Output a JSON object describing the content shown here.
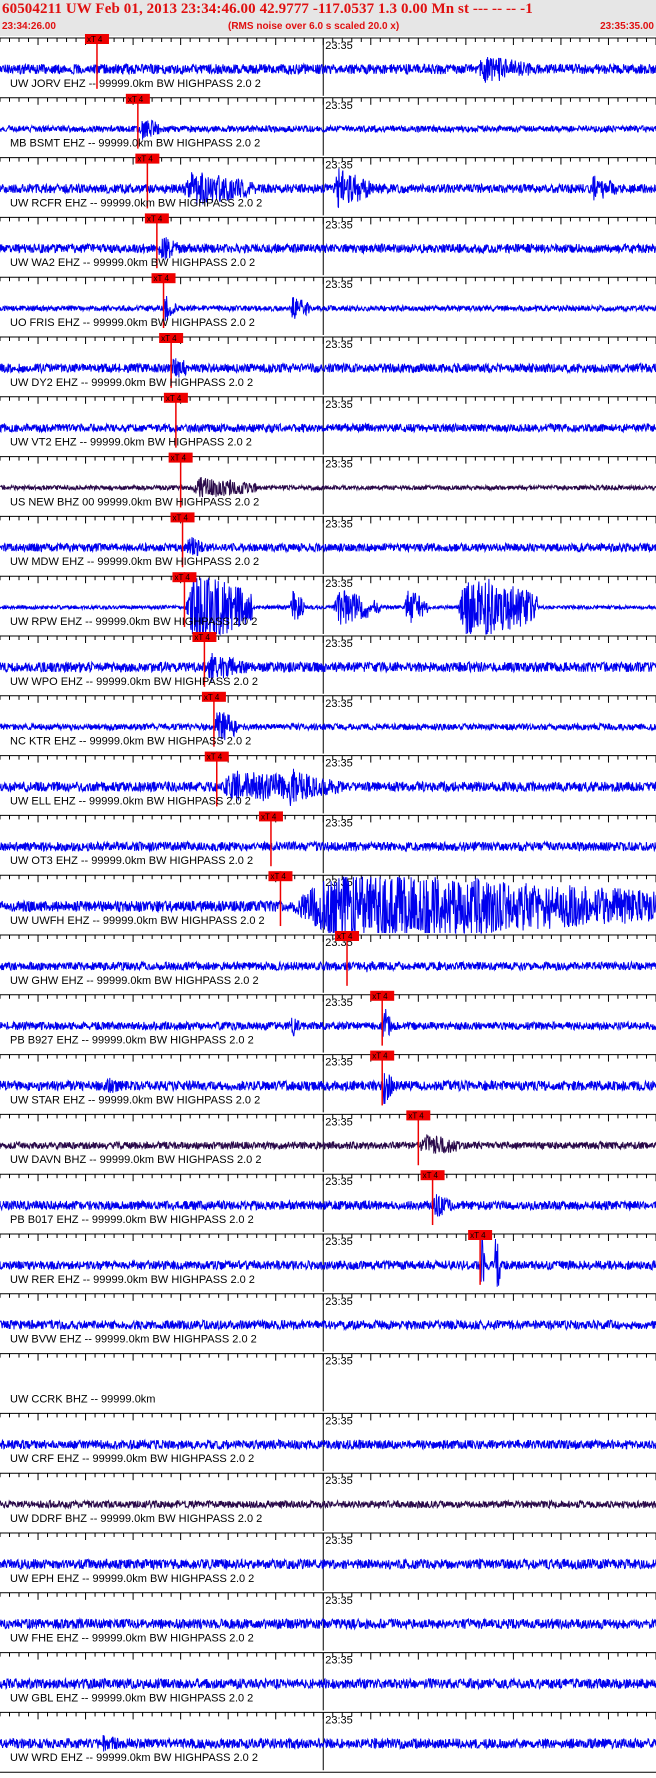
{
  "header": {
    "title": "60504211 UW Feb 01, 2013 23:34:46.00   42.9777 -117.0537  1.3 0.00 Mn st --- -- --  -1",
    "start_time": "23:34:26.00",
    "subtitle": "(RMS noise over 6.0 s scaled 20.0 x)",
    "end_time": "23:35:35.00"
  },
  "colors": {
    "header_text": "#e01010",
    "header_bg": "#e6e6e6",
    "trace_blue": "#0000ee",
    "trace_dark": "#2a0a4a",
    "pick_red": "#ee0000"
  },
  "chart_data": {
    "type": "line",
    "x_range": [
      "23:34:26.00",
      "23:35:35.00"
    ],
    "tick_label": "23:35",
    "pick_label": "xT 4",
    "channels": [
      {
        "label": "UW JORV EHZ -- 99999.0km BW  HIGHPASS  2.0  2",
        "color": "blue",
        "pick": "23:34:36.2",
        "amp": 0.55,
        "bursts": [
          [
            "23:35:16.0",
            "23:35:22.0",
            3.0
          ]
        ]
      },
      {
        "label": "MB BSMT EHZ -- 99999.0km BW  HIGHPASS  2.0  2",
        "color": "blue",
        "pick": "23:34:40.5",
        "amp": 0.35,
        "bursts": [
          [
            "23:34:40.5",
            "23:34:43.0",
            4.0
          ]
        ]
      },
      {
        "label": "UW RCFR EHZ -- 99999.0km BW  HIGHPASS  2.0  2",
        "color": "blue",
        "pick": "23:34:41.5",
        "amp": 0.5,
        "bursts": [
          [
            "23:34:45.0",
            "23:34:53.0",
            4.0
          ],
          [
            "23:35:01.0",
            "23:35:05.0",
            4.5
          ],
          [
            "23:35:28.0",
            "23:35:31.0",
            3.0
          ]
        ]
      },
      {
        "label": "UW WA2 EHZ -- 99999.0km BW  HIGHPASS  2.0  2",
        "color": "blue",
        "pick": "23:34:42.5",
        "amp": 0.5,
        "bursts": [
          [
            "23:34:42.5",
            "23:34:45.0",
            3.0
          ]
        ]
      },
      {
        "label": "UO FRIS EHZ -- 99999.0km BW  HIGHPASS  2.0  2",
        "color": "blue",
        "pick": "23:34:43.2",
        "amp": 0.3,
        "bursts": [
          [
            "23:34:43.2",
            "23:34:44.5",
            5.0
          ],
          [
            "23:34:56.5",
            "23:34:58.5",
            5.0
          ]
        ]
      },
      {
        "label": "UW DY2 EHZ -- 99999.0km BW  HIGHPASS  2.0  2",
        "color": "blue",
        "pick": "23:34:44.0",
        "amp": 0.5,
        "bursts": [
          [
            "23:34:44.0",
            "23:34:46.0",
            3.0
          ]
        ]
      },
      {
        "label": "UW VT2 EHZ -- 99999.0km BW  HIGHPASS  2.0  2",
        "color": "blue",
        "pick": "23:34:44.5",
        "amp": 0.45,
        "bursts": []
      },
      {
        "label": "US NEW BHZ 00 99999.0km BW  HIGHPASS  2.0  2",
        "color": "dark",
        "pick": "23:34:45.0",
        "amp": 0.25,
        "bursts": [
          [
            "23:34:46.0",
            "23:34:53.0",
            5.0
          ]
        ]
      },
      {
        "label": "UW MDW EHZ -- 99999.0km BW  HIGHPASS  2.0  2",
        "color": "blue",
        "pick": "23:34:45.2",
        "amp": 0.45,
        "bursts": [
          [
            "23:34:45.5",
            "23:34:47.5",
            3.0
          ]
        ]
      },
      {
        "label": "UW RPW EHZ -- 99999.0km BW  HIGHPASS  2.0  2",
        "color": "blue",
        "pick": "23:34:45.4",
        "amp": 0.2,
        "bursts": [
          [
            "23:34:45.4",
            "23:34:52.5",
            22.0
          ],
          [
            "23:34:56.5",
            "23:34:58.0",
            10.0
          ],
          [
            "23:35:01.0",
            "23:35:06.0",
            10.0
          ],
          [
            "23:35:08.5",
            "23:35:11.0",
            10.0
          ],
          [
            "23:35:14.0",
            "23:35:22.5",
            20.0
          ]
        ]
      },
      {
        "label": "UW WPO EHZ -- 99999.0km BW  HIGHPASS  2.0  2",
        "color": "blue",
        "pick": "23:34:47.5",
        "amp": 0.55,
        "bursts": [
          [
            "23:34:47.5",
            "23:34:52.0",
            3.0
          ]
        ]
      },
      {
        "label": "NC KTR EHZ -- 99999.0km BW  HIGHPASS  2.0  2",
        "color": "blue",
        "pick": "23:34:48.5",
        "amp": 0.35,
        "bursts": [
          [
            "23:34:48.5",
            "23:34:51.0",
            6.0
          ]
        ]
      },
      {
        "label": "UW ELL EHZ -- 99999.0km BW  HIGHPASS  2.0  2",
        "color": "blue",
        "pick": "23:34:48.8",
        "amp": 0.55,
        "bursts": [
          [
            "23:34:48.8",
            "23:35:02.0",
            3.5
          ],
          [
            "23:34:56.0",
            "23:34:59.5",
            4.0
          ]
        ]
      },
      {
        "label": "UW OT3 EHZ -- 99999.0km BW  HIGHPASS  2.0  2",
        "color": "blue",
        "pick": "23:34:54.5",
        "amp": 0.5,
        "bursts": []
      },
      {
        "label": "UW UWFH EHZ -- 99999.0km BW  HIGHPASS  2.0  2",
        "color": "blue",
        "pick": "23:34:55.5",
        "amp": 0.6,
        "bursts": [
          [
            "23:34:56.0",
            "23:35:35.0",
            7.0
          ]
        ]
      },
      {
        "label": "UW GHW EHZ -- 99999.0km BW  HIGHPASS  2.0  2",
        "color": "blue",
        "pick": "23:35:02.5",
        "amp": 0.45,
        "bursts": [
          [
            "23:35:04.0",
            "23:35:07.0",
            1.6
          ]
        ]
      },
      {
        "label": "PB B927 EHZ -- 99999.0km BW  HIGHPASS  2.0  2",
        "color": "blue",
        "pick": "23:35:06.2",
        "amp": 0.45,
        "bursts": [
          [
            "23:35:06.2",
            "23:35:07.2",
            5.0
          ],
          [
            "23:34:56.5",
            "23:34:57.5",
            3.0
          ]
        ]
      },
      {
        "label": "UW STAR EHZ -- 99999.0km BW  HIGHPASS  2.0  2",
        "color": "blue",
        "pick": "23:35:06.2",
        "amp": 0.55,
        "bursts": [
          [
            "23:35:06.2",
            "23:35:07.5",
            4.0
          ],
          [
            "23:34:37.0",
            "23:34:39.0",
            2.0
          ]
        ]
      },
      {
        "label": "UW DAVN BHZ -- 99999.0km BW  HIGHPASS  2.0  2",
        "color": "dark",
        "pick": "23:35:10.0",
        "amp": 0.4,
        "bursts": [
          [
            "23:35:10.0",
            "23:35:14.5",
            3.5
          ]
        ]
      },
      {
        "label": "PB B017 EHZ -- 99999.0km BW  HIGHPASS  2.0  2",
        "color": "blue",
        "pick": "23:35:11.5",
        "amp": 0.5,
        "bursts": [
          [
            "23:35:11.5",
            "23:35:13.5",
            3.0
          ]
        ]
      },
      {
        "label": "UW RER EHZ -- 99999.0km BW  HIGHPASS  2.0  2",
        "color": "blue",
        "pick": "23:35:16.5",
        "amp": 0.5,
        "bursts": [
          [
            "23:35:16.5",
            "23:35:17.0",
            8.0
          ],
          [
            "23:35:18.0",
            "23:35:18.6",
            8.0
          ]
        ]
      },
      {
        "label": "UW BVW EHZ -- 99999.0km BW  HIGHPASS  2.0  2",
        "color": "blue",
        "pick": null,
        "amp": 0.5,
        "bursts": []
      },
      {
        "label": "UW CCRK BHZ -- 99999.0km",
        "color": "none",
        "pick": null,
        "amp": 0,
        "bursts": []
      },
      {
        "label": "UW CRF EHZ -- 99999.0km BW  HIGHPASS  2.0  2",
        "color": "blue",
        "pick": null,
        "amp": 0.5,
        "bursts": []
      },
      {
        "label": "UW DDRF BHZ -- 99999.0km BW  HIGHPASS  2.0  2",
        "color": "dark",
        "pick": null,
        "amp": 0.4,
        "bursts": []
      },
      {
        "label": "UW EPH EHZ -- 99999.0km BW  HIGHPASS  2.0  2",
        "color": "blue",
        "pick": null,
        "amp": 0.55,
        "bursts": []
      },
      {
        "label": "UW FHE EHZ -- 99999.0km BW  HIGHPASS  2.0  2",
        "color": "blue",
        "pick": null,
        "amp": 0.55,
        "bursts": []
      },
      {
        "label": "UW GBL EHZ -- 99999.0km BW  HIGHPASS  2.0  2",
        "color": "blue",
        "pick": null,
        "amp": 0.55,
        "bursts": []
      },
      {
        "label": "UW WRD EHZ -- 99999.0km BW  HIGHPASS  2.0  2",
        "color": "blue",
        "pick": null,
        "amp": 0.55,
        "bursts": [
          [
            "23:34:36.5",
            "23:34:39.0",
            2.0
          ]
        ]
      }
    ]
  }
}
